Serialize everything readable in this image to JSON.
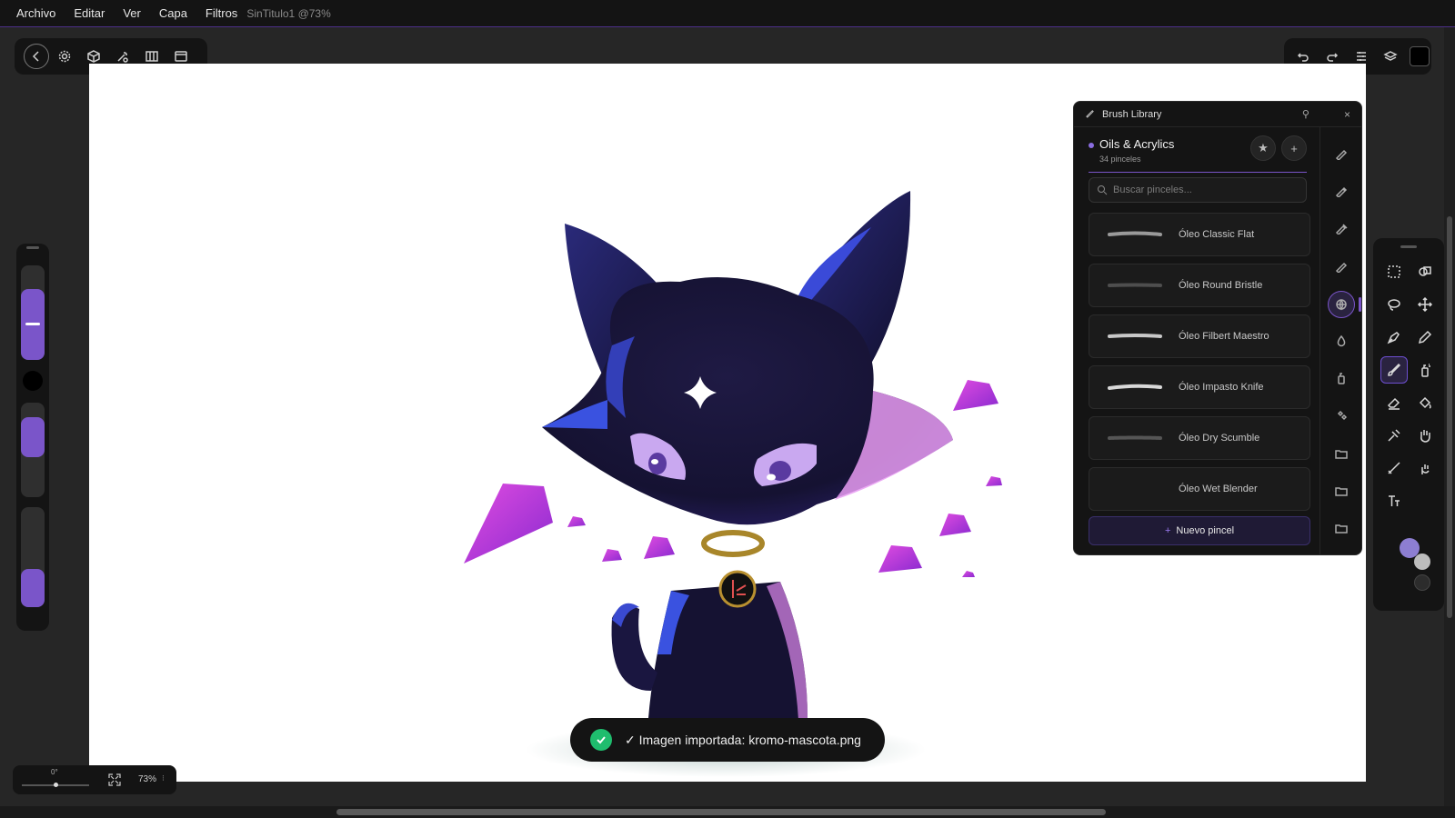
{
  "menubar": {
    "items": [
      "Archivo",
      "Editar",
      "Ver",
      "Capa",
      "Filtros"
    ],
    "document_title": "SinTitulo1 @73%"
  },
  "top_left_toolbar": {
    "icons": [
      "back-icon",
      "gear-icon",
      "cube-icon",
      "wand-icon",
      "stripes-icon",
      "window-icon"
    ]
  },
  "top_right_toolbar": {
    "icons": [
      "undo-icon",
      "redo-icon",
      "adjustments-icon",
      "layers-icon"
    ],
    "color_swatch": "#000000"
  },
  "left_panel": {
    "primary_slot_color": "#7a55c9",
    "color_swatch": "#000000"
  },
  "brush_library": {
    "title": "Brush Library",
    "category": {
      "name": "Oils & Acrylics",
      "count": "34 pinceles"
    },
    "search_placeholder": "Buscar pinceles...",
    "brushes": [
      {
        "name": "Óleo Classic Flat"
      },
      {
        "name": "Óleo Round Bristle"
      },
      {
        "name": "Óleo Filbert Maestro"
      },
      {
        "name": "Óleo Impasto Knife"
      },
      {
        "name": "Óleo Dry Scumble"
      },
      {
        "name": "Óleo Wet Blender"
      }
    ],
    "new_brush_label": "Nuevo pincel",
    "side_icons": [
      "pen-icon",
      "pencil-icon",
      "marker-icon",
      "inking-icon",
      "globe-icon",
      "drop-icon",
      "spray-icon",
      "sparkle-icon",
      "folder-icon",
      "folder-icon",
      "folder-icon"
    ]
  },
  "toolbox": {
    "active_tool": "brush-tool",
    "colors": {
      "primary": "#8d7ed2",
      "secondary": "#bdbdbd",
      "tertiary": "#3a3a3a"
    }
  },
  "zoom_panel": {
    "rotation": "0°",
    "zoom": "73%"
  },
  "toast": {
    "message": "✓ Imagen importada: kromo-mascota.png"
  },
  "colors": {
    "accent": "#7a55c9",
    "success": "#1fbd6e",
    "panel": "#141414"
  }
}
